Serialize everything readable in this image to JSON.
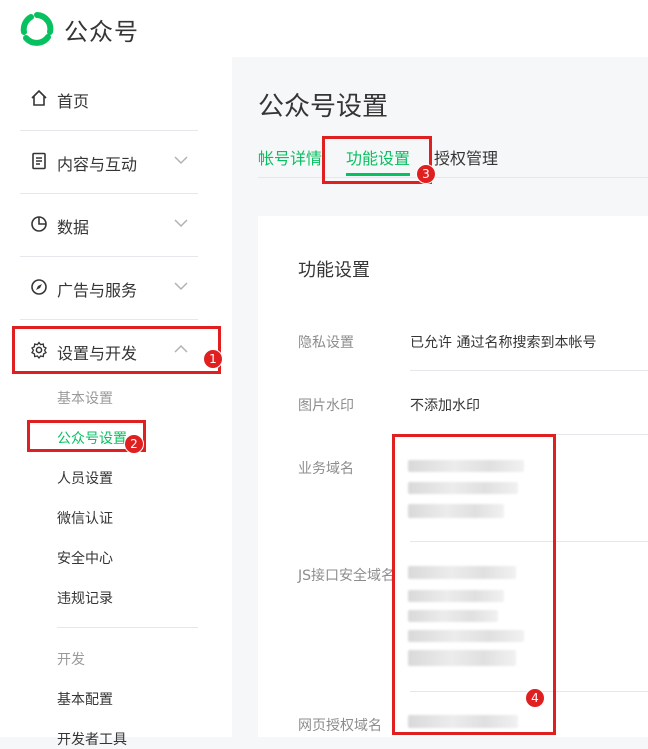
{
  "header": {
    "brand": "公众号",
    "logo_icon": "wechat-official-account-logo",
    "brand_color": "#07c160"
  },
  "sidebar": {
    "items": [
      {
        "label": "首页",
        "icon": "home-icon"
      },
      {
        "label": "内容与互动",
        "icon": "document-icon"
      },
      {
        "label": "数据",
        "icon": "pie-chart-icon"
      },
      {
        "label": "广告与服务",
        "icon": "compass-icon"
      },
      {
        "label": "设置与开发",
        "icon": "gear-icon",
        "expanded": true
      }
    ],
    "sub_items": {
      "group1_title": "基本设置",
      "account_settings": "公众号设置",
      "staff_settings": "人员设置",
      "wechat_verify": "微信认证",
      "security_center": "安全中心",
      "violation_records": "违规记录",
      "group2_title": "开发",
      "basic_config": "基本配置",
      "dev_tools": "开发者工具"
    }
  },
  "main": {
    "title": "公众号设置",
    "tabs": [
      {
        "label": "帐号详情"
      },
      {
        "label": "功能设置",
        "active": true
      },
      {
        "label": "授权管理"
      }
    ],
    "card": {
      "title": "功能设置",
      "rows": [
        {
          "label": "隐私设置",
          "value": "已允许 通过名称搜索到本帐号"
        },
        {
          "label": "图片水印",
          "value": "不添加水印"
        },
        {
          "label": "业务域名",
          "value": ""
        },
        {
          "label": "JS接口安全域名",
          "value": ""
        },
        {
          "label": "网页授权域名",
          "value": ""
        }
      ]
    }
  },
  "annotations": [
    "1",
    "2",
    "3",
    "4"
  ],
  "colors": {
    "accent": "#07c160",
    "highlight": "#e02020"
  }
}
